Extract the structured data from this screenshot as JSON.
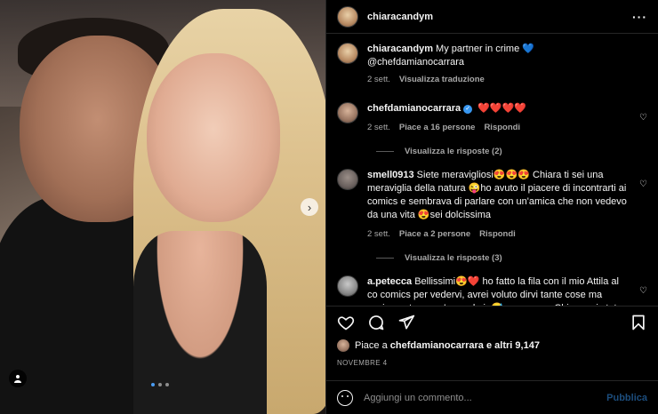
{
  "post": {
    "author": "chiaracandym",
    "more_icon": "more-horizontal-icon"
  },
  "caption": {
    "user": "chiaracandym",
    "text": "My partner in crime 💙 @chefdamianocarrara",
    "time": "2 sett.",
    "translate": "Visualizza traduzione"
  },
  "comments": [
    {
      "user": "chefdamianocarrara",
      "verified": true,
      "text": "❤️❤️❤️❤️",
      "time": "2 sett.",
      "likes": "Piace a 16 persone",
      "reply": "Rispondi",
      "view_replies": "Visualizza le risposte (2)"
    },
    {
      "user": "smell0913",
      "text": "Siete meravigliosi😍😍😍 Chiara ti sei una meraviglia della natura 😜ho avuto il piacere di incontrarti ai comics e sembrava di parlare con un'amica che non vedevo da una vita 😍sei dolcissima",
      "time": "2 sett.",
      "likes": "Piace a 2 persone",
      "reply": "Rispondi",
      "view_replies": "Visualizza le risposte (3)"
    },
    {
      "user": "a.petecca",
      "text": "Bellissimi😍❤️ ho fatto la fila con il mio Attila al co comics per vedervi, avrei voluto dirvi tante cose ma ovviamente non c'ero solo io😅 comunque Chiara sei stata"
    }
  ],
  "likes": {
    "prefix": "Piace a",
    "user": "chefdamianocarrara",
    "suffix": "e altri 9,147"
  },
  "date": "NOVEMBRE 4",
  "add_comment": {
    "placeholder": "Aggiungi un commento...",
    "post_label": "Pubblica"
  },
  "photo": {
    "next_icon": "chevron-right-icon",
    "tag_icon": "user-tag-icon",
    "page": 1,
    "pages": 3
  },
  "colors": {
    "background": "#000000",
    "text": "#f5f5f5",
    "muted": "#a8a8a8",
    "verified": "#3897f0",
    "post_disabled": "#1c4d7d"
  }
}
